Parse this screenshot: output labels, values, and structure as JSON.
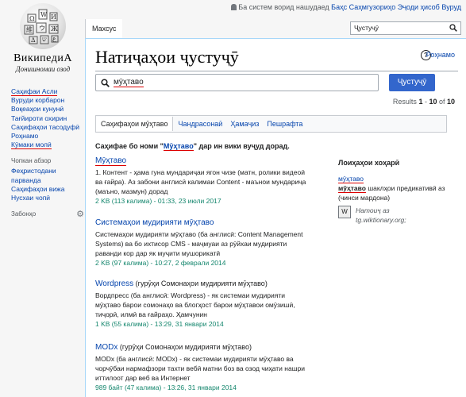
{
  "personal": {
    "anon": "Ба систем ворид нашудаед",
    "talk": "Баҳс",
    "contribs": "Саҳмгузориҳо",
    "create": "Эҷоди ҳисоб",
    "login": "Вуруд"
  },
  "logo": {
    "wordmark": "ВикипедиА",
    "tagline": "Донишномаи озод"
  },
  "sidebar": {
    "nav": [
      "Саҳифаи Асли",
      "Вуруди корбарон",
      "Воқеаҳои кунунӣ",
      "Тағйироти охирин",
      "Саҳифаҳои тасодуфӣ",
      "Роҳнамо",
      "Кӯмаки молӣ"
    ],
    "tools_heading": "Чопкан абзор",
    "tools": [
      "Феҳристодани парванда",
      "Саҳифаҳои вижа",
      "Нусхаи чопӣ"
    ],
    "lang_heading": "Забонҳо"
  },
  "tabs": {
    "special": "Махсус"
  },
  "top_search": {
    "value": "Ҷустуҷӯ"
  },
  "page": {
    "title": "Натиҷаҳои ҷустуҷӯ",
    "help": "Роҳнамо",
    "query": "мӯҳтаво",
    "search_button": "Ҷустуҷӯ",
    "results_prefix": "Results",
    "results_from": "1",
    "results_sep": " - ",
    "results_to": "10",
    "results_of": " of ",
    "results_total": "10"
  },
  "filters": [
    "Саҳифаҳои мӯҳтаво",
    "Чандрасонаӣ",
    "Ҳамаҷиз",
    "Пешрафта"
  ],
  "notice": {
    "before": "Саҳифае бо номи \"",
    "link": "Мӯҳтаво",
    "after": "\" дар ин вики вуҷуд дорад."
  },
  "results": [
    {
      "title": "Мӯҳтаво",
      "snippet": "1. Контент - ҳама гуна мундариҷаи ягон чизе (матн, ролики видеоӣ ва ғайра). Аз забони англисӣ калимаи Content - маънои мундариҷа (маъно, мазмун) дорад",
      "meta": "2 KB (113 калима) - 01:33, 23 июли 2017"
    },
    {
      "title": "Системаҳои мудирияти мӯҳтаво",
      "snippet": "Системаҳои мудирияти мӯҳтаво (ба англисӣ: Content Management Systems) ва бо ихтисор CMS - маҷмуаи аз рӯйхаи мудирияти раванди кор дар як муҷити мушорикатӣ",
      "meta": "2 KB (97 калима) - 10:27, 2 феврали 2014"
    },
    {
      "title": "Wordpress",
      "title_suffix": " (гурӯҳи Сомонаҳои мудирияти мӯҳтаво)",
      "snippet": "Вордпресс (ба англисӣ: Wordpress) - як системаи мудирияти мӯҳтаво барои сомонаҳо ва блогҳост барои мӯҳтавои омӯзишӣ, тиҷорӣ, илмӣ ва ғайраҳо. Ҳамчунин",
      "meta": "1 KB (55 калима) - 13:29, 31 январи 2014"
    },
    {
      "title": "MODx",
      "title_suffix": " (гурӯҳи Сомонаҳои мудирияти мӯҳтаво)",
      "snippet": "MODx (ба англисӣ: MODx) - як системаи мудирияти мӯҳтаво ва чорчӯбаи нармафзори тахти вебӣ матни боз ва озод чиҳати нашри иттилоот дар веб ва Интернет",
      "meta": "989 байт (47 калима) - 13:26, 31 январи 2014"
    }
  ],
  "sister": {
    "heading": "Лоиҳаҳои хоҳарӣ",
    "word": "мӯҳтаво",
    "def_word": "мӯҳтаво",
    "def_rest": " шаклҳои предикативӣ аз (чинси мардона)",
    "source_label": "Натоиҷ аз",
    "source": "tg.wiktionary.org;"
  }
}
